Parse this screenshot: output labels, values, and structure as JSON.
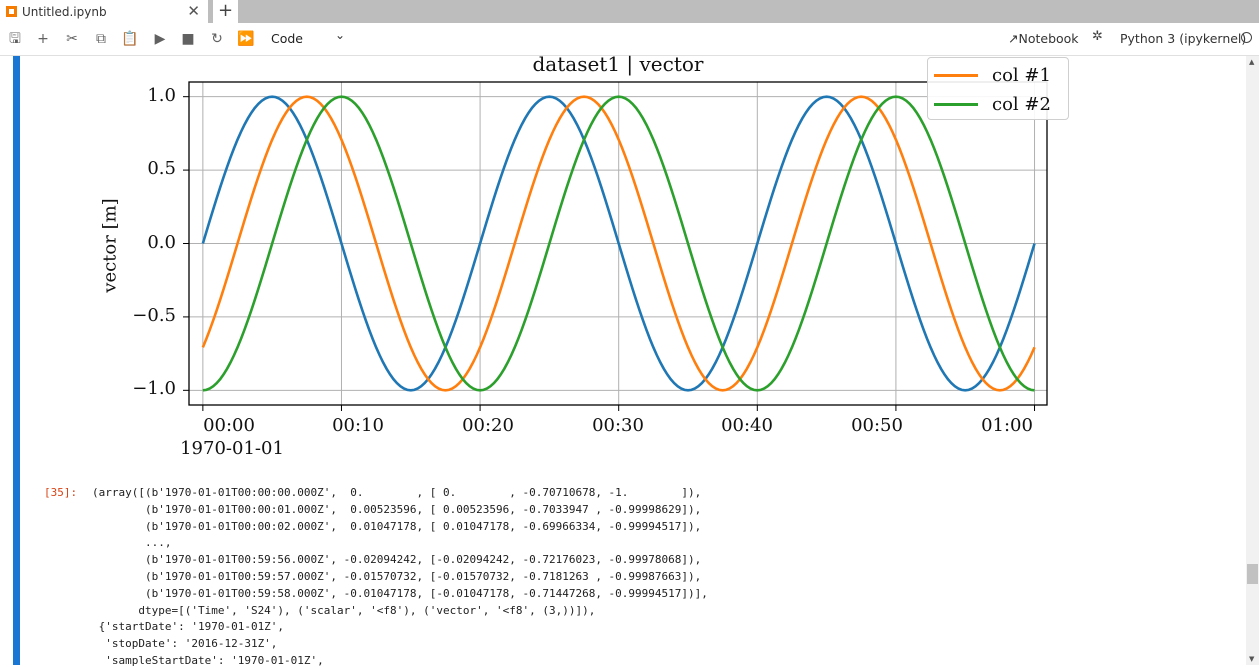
{
  "tab": {
    "title": "Untitled.ipynb",
    "close_glyph": "✕",
    "add_glyph": "+"
  },
  "toolbar": {
    "buttons": [
      {
        "name": "save-icon",
        "glyph": "🖫"
      },
      {
        "name": "add-cell-icon",
        "glyph": "+"
      },
      {
        "name": "cut-icon",
        "glyph": "✂"
      },
      {
        "name": "copy-icon",
        "glyph": "⧉"
      },
      {
        "name": "paste-icon",
        "glyph": "📋"
      },
      {
        "name": "run-icon",
        "glyph": "▶"
      },
      {
        "name": "stop-icon",
        "glyph": "■"
      },
      {
        "name": "restart-icon",
        "glyph": "↻"
      },
      {
        "name": "fast-forward-icon",
        "glyph": "⏩"
      }
    ],
    "cell_type": "Code",
    "cell_type_chevron": "⌄",
    "notebook_link": "Notebook",
    "kernel_icon": "bug-icon",
    "kernel_glyph": "✲",
    "kernel_name": "Python 3 (ipykernel)"
  },
  "chart_data": {
    "type": "line",
    "title": "dataset1 | vector",
    "ylabel": "vector [m]",
    "xlabel": "",
    "x_tick_labels": [
      "00:00",
      "00:10",
      "00:20",
      "00:30",
      "00:40",
      "00:50",
      "01:00"
    ],
    "x_date_label": "1970-01-01",
    "y_tick_labels": [
      "1.0",
      "0.5",
      "0.0",
      "−0.5",
      "−1.0"
    ],
    "y_ticks": [
      1.0,
      0.5,
      0.0,
      -0.5,
      -1.0
    ],
    "xlim_minutes": [
      -1,
      60.9
    ],
    "ylim": [
      -1.1,
      1.1
    ],
    "grid": true,
    "legend_position": "top-right",
    "series": [
      {
        "name": "",
        "color": "#1f77b4",
        "period_minutes": 20,
        "phase_deg": 0,
        "amplitude": 1,
        "x_range_minutes": [
          0,
          60
        ]
      },
      {
        "name": "col #1",
        "color": "#ff7f0e",
        "period_minutes": 20,
        "phase_deg": -45,
        "amplitude": 1,
        "x_range_minutes": [
          0,
          60
        ]
      },
      {
        "name": "col #2",
        "color": "#2ca02c",
        "period_minutes": 20,
        "phase_deg": -90,
        "amplitude": 1,
        "x_range_minutes": [
          0,
          60
        ]
      }
    ]
  },
  "output": {
    "prompt": "[35]:",
    "lines": [
      "(array([(b'1970-01-01T00:00:00.000Z',  0.        , [ 0.        , -0.70710678, -1.        ]),",
      "        (b'1970-01-01T00:00:01.000Z',  0.00523596, [ 0.00523596, -0.7033947 , -0.99998629]),",
      "        (b'1970-01-01T00:00:02.000Z',  0.01047178, [ 0.01047178, -0.69966334, -0.99994517]),",
      "        ...,",
      "        (b'1970-01-01T00:59:56.000Z', -0.02094242, [-0.02094242, -0.72176023, -0.99978068]),",
      "        (b'1970-01-01T00:59:57.000Z', -0.01570732, [-0.01570732, -0.7181263 , -0.99987663]),",
      "        (b'1970-01-01T00:59:58.000Z', -0.01047178, [-0.01047178, -0.71447268, -0.99994517])],",
      "       dtype=[('Time', 'S24'), ('scalar', '<f8'), ('vector', '<f8', (3,))]),",
      " {'startDate': '1970-01-01Z',",
      "  'stopDate': '2016-12-31Z',",
      "  'sampleStartDate': '1970-01-01Z',"
    ]
  },
  "colors": {
    "collapser": "#1976d2",
    "prompt": "#d84315"
  }
}
